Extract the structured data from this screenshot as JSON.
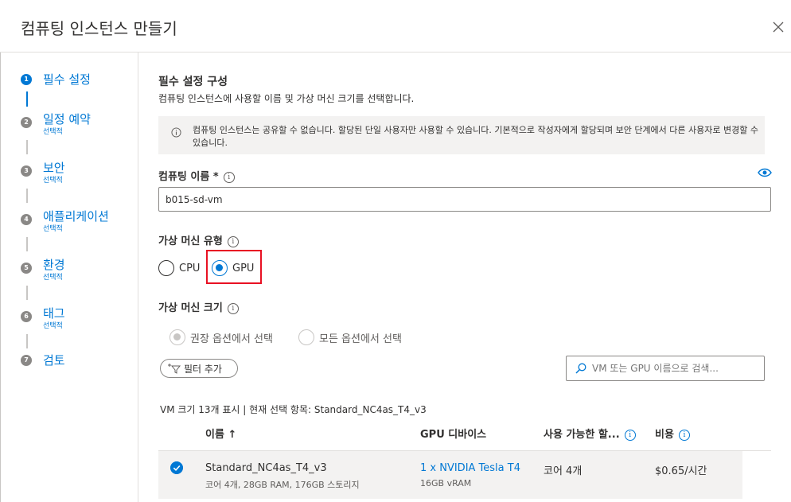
{
  "window": {
    "title": "컴퓨팅 인스턴스 만들기"
  },
  "nav": {
    "steps": [
      {
        "num": "1",
        "label": "필수 설정",
        "sub": ""
      },
      {
        "num": "2",
        "label": "일정 예약",
        "sub": "선택적"
      },
      {
        "num": "3",
        "label": "보안",
        "sub": "선택적"
      },
      {
        "num": "4",
        "label": "애플리케이션",
        "sub": "선택적"
      },
      {
        "num": "5",
        "label": "환경",
        "sub": "선택적"
      },
      {
        "num": "6",
        "label": "태그",
        "sub": "선택적"
      },
      {
        "num": "7",
        "label": "검토",
        "sub": ""
      }
    ]
  },
  "main": {
    "heading": "필수 설정 구성",
    "description": "컴퓨팅 인스턴스에 사용할 이름 및 가상 머신 크기를 선택합니다.",
    "info": "컴퓨팅 인스턴스는 공유할 수 없습니다. 할당된 단일 사용자만 사용할 수 있습니다. 기본적으로 작성자에게 할당되며 보안 단계에서 다른 사용자로 변경할 수 있습니다.",
    "compute_name_label": "컴퓨팅 이름 *",
    "compute_name_value": "b015-sd-vm",
    "vm_type_label": "가상 머신 유형",
    "vm_type_options": [
      "CPU",
      "GPU"
    ],
    "vm_type_selected": "GPU",
    "vm_size_label": "가상 머신 크기",
    "vm_size_options": [
      "권장 옵션에서 선택",
      "모든 옵션에서 선택"
    ],
    "filter_button": "필터 추가",
    "search_placeholder": "VM 또는 GPU 이름으로 검색...",
    "count_text": "VM 크기 13개 표시 | 현재 선택 항목: Standard_NC4as_T4_v3",
    "columns": {
      "name": "이름 ↑",
      "gpu": "GPU 디바이스",
      "available": "사용 가능한 할...",
      "cost": "비용"
    },
    "rows": [
      {
        "name": "Standard_NC4as_T4_v3",
        "specs": "코어 4개, 28GB RAM, 176GB 스토리지",
        "gpu": "1 x NVIDIA Tesla T4",
        "gpu_mem": "16GB vRAM",
        "available": "코어 4개",
        "cost": "$0.65/시간"
      }
    ]
  },
  "colors": {
    "accent": "#0078d4",
    "highlight": "#e81123"
  },
  "icons": [
    "close-icon",
    "info-icon",
    "eye-icon",
    "filter-icon",
    "search-icon",
    "checkmark-icon"
  ]
}
